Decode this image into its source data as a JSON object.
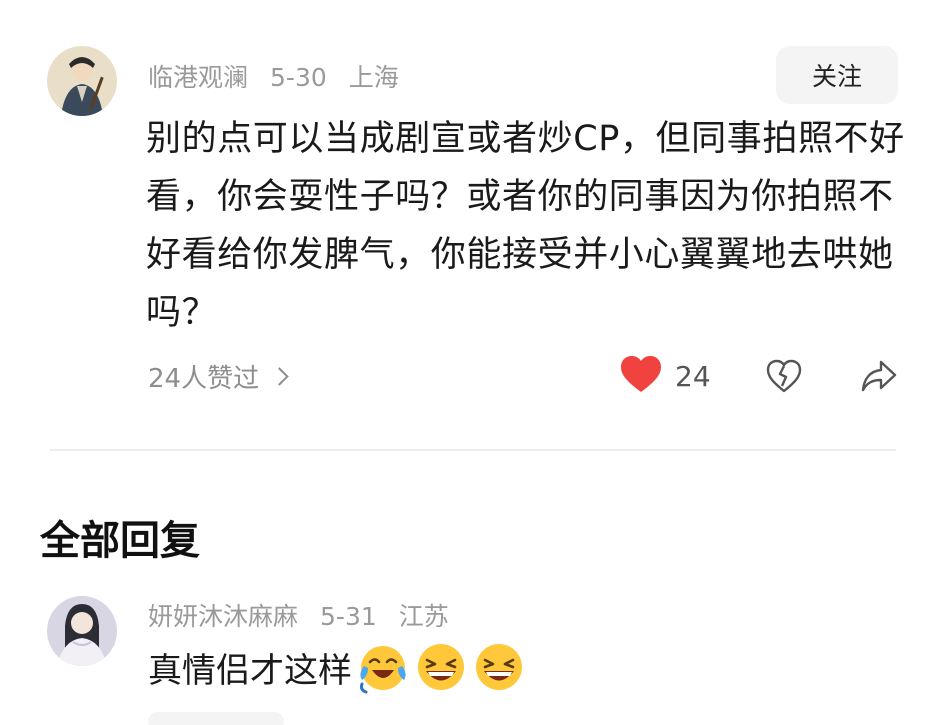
{
  "comment": {
    "author": "临港观澜",
    "date": "5-30",
    "location": "上海",
    "follow_label": "关注",
    "text": "别的点可以当成剧宣或者炒CP，但同事拍照不好看，你会耍性子吗？或者你的同事因为你拍照不好看给你发脾气，你能接受并小心翼翼地去哄她吗？",
    "likes_text": "24人赞过",
    "like_count": "24",
    "colors": {
      "heart": "#f0433f",
      "meta": "#9a9a9a"
    },
    "icons": [
      "heart-icon",
      "broken-heart-icon",
      "share-icon",
      "chevron-right-icon"
    ]
  },
  "section": {
    "title": "全部回复"
  },
  "reply": {
    "author": "妍妍沐沐麻麻",
    "date": "5-31",
    "location": "江苏",
    "text": "真情侣才这样",
    "emojis": [
      "crying-laughing-emoji",
      "grinning-emoji",
      "grinning-emoji"
    ]
  }
}
